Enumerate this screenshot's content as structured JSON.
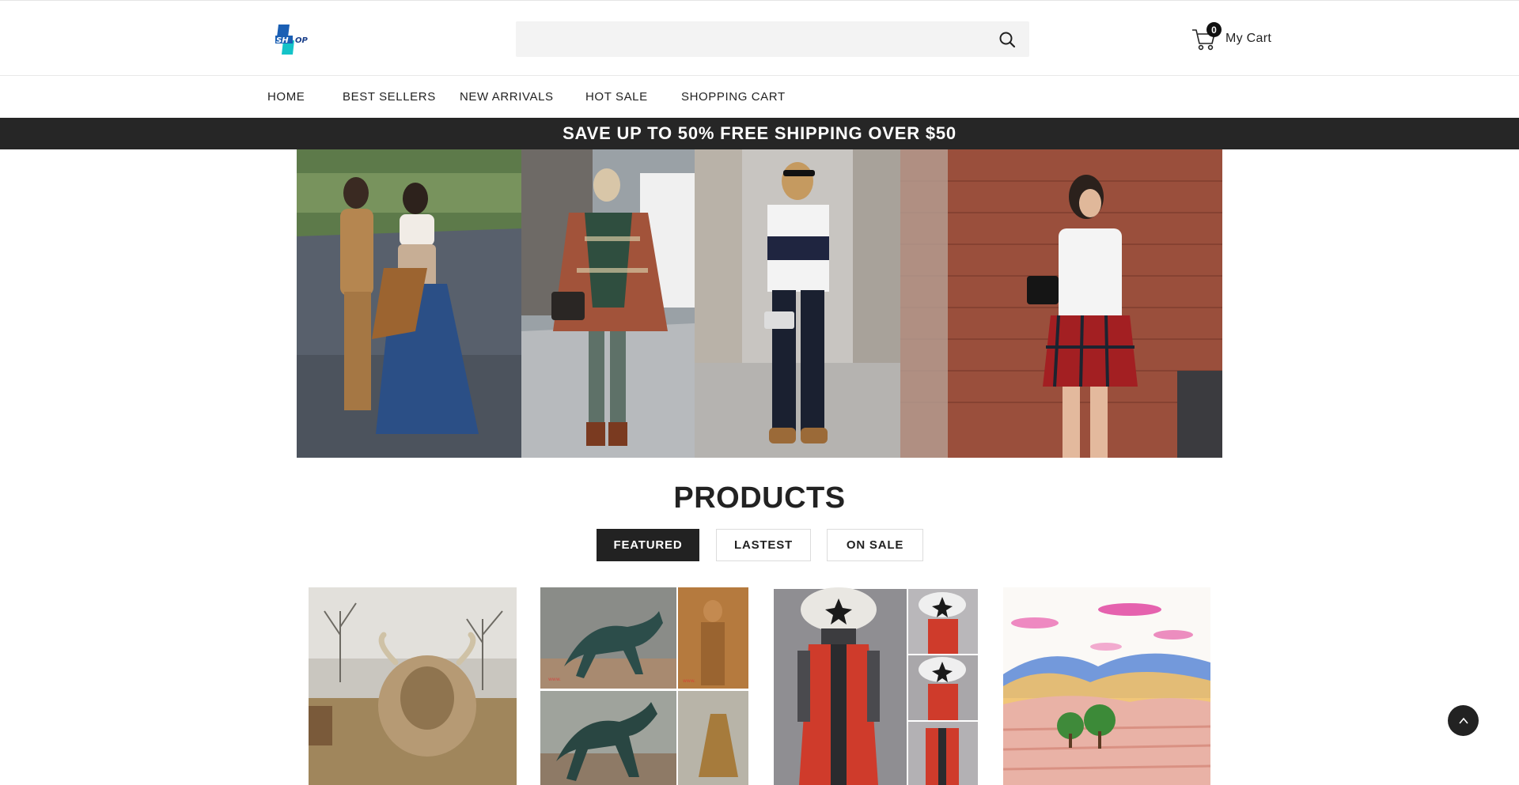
{
  "header": {
    "logo_text": "SHOP",
    "search": {
      "placeholder": "",
      "value": ""
    },
    "cart": {
      "count": "0",
      "label": "My Cart"
    }
  },
  "nav": {
    "items": [
      {
        "label": "HOME"
      },
      {
        "label": "BEST SELLERS"
      },
      {
        "label": "NEW ARRIVALS"
      },
      {
        "label": "HOT SALE"
      },
      {
        "label": "SHOPPING CART"
      }
    ]
  },
  "promo": {
    "text": "SAVE UP TO 50% FREE SHIPPING OVER $50"
  },
  "hero": {
    "panels": [
      "street-style-two-women",
      "plaid-poncho-woman",
      "striped-tee-woman",
      "white-tee-plaid-skirt-woman"
    ]
  },
  "products": {
    "title": "PRODUCTS",
    "tabs": [
      {
        "label": "FEATURED",
        "active": true
      },
      {
        "label": "LASTEST",
        "active": false
      },
      {
        "label": "ON SALE",
        "active": false
      }
    ],
    "items": [
      {
        "image": "highland-cow-photo"
      },
      {
        "image": "bronze-horse-statues-collage"
      },
      {
        "image": "red-armored-figure-collage"
      },
      {
        "image": "watercolor-landscape-painting"
      }
    ]
  },
  "colors": {
    "promo_bg": "#262626",
    "active_tab_bg": "#222222",
    "logo_blue": "#1a5fb4",
    "logo_teal": "#13c3c8"
  }
}
